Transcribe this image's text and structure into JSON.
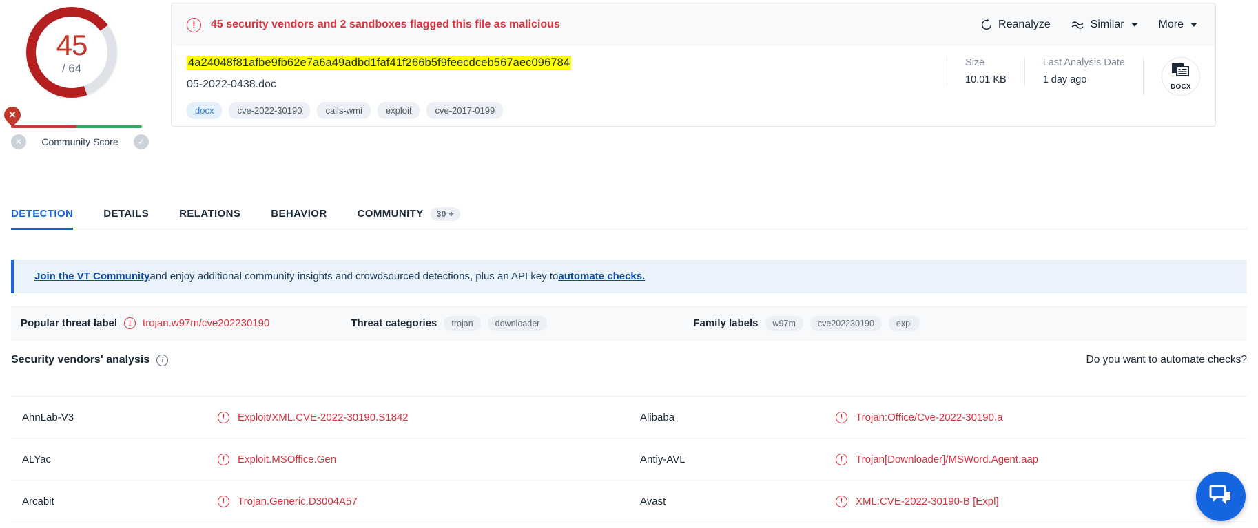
{
  "score": {
    "detections": "45",
    "total": "/ 64",
    "community_score_label": "Community Score",
    "negative_icon": "✕",
    "positive_icon": "✓",
    "pin_icon": "✕",
    "ring_color": "#b51f1f",
    "ring_track_color": "#dfe3e8"
  },
  "alert": {
    "message": "45 security vendors and 2 sandboxes flagged this file as malicious",
    "color": "#d9333f",
    "icon": "!"
  },
  "actions": {
    "reanalyze": "Reanalyze",
    "similar": "Similar",
    "more": "More"
  },
  "file": {
    "hash": "4a24048f81afbe9fb62e7a6a49adbd1faf41f266b5f9feecdceb567aec096784",
    "name": "05-2022-0438.doc",
    "tags": [
      {
        "label": "docx",
        "style": "blue"
      },
      {
        "label": "cve-2022-30190",
        "style": "grey"
      },
      {
        "label": "calls-wmi",
        "style": "grey"
      },
      {
        "label": "exploit",
        "style": "grey"
      },
      {
        "label": "cve-2017-0199",
        "style": "grey"
      }
    ],
    "size_label": "Size",
    "size_value": "10.01 KB",
    "last_analysis_label": "Last Analysis Date",
    "last_analysis_value": "1 day ago",
    "type_icon_label": "DOCX"
  },
  "tabs": [
    {
      "label": "DETECTION",
      "active": true,
      "badge": ""
    },
    {
      "label": "DETAILS",
      "active": false,
      "badge": ""
    },
    {
      "label": "RELATIONS",
      "active": false,
      "badge": ""
    },
    {
      "label": "BEHAVIOR",
      "active": false,
      "badge": ""
    },
    {
      "label": "COMMUNITY",
      "active": false,
      "badge": "30 +"
    }
  ],
  "banner": {
    "link1": "Join the VT Community",
    "middle": " and enjoy additional community insights and crowdsourced detections, plus an API key to ",
    "link2": "automate checks."
  },
  "threat": {
    "popular_label": "Popular threat label",
    "popular_value": "trojan.w97m/cve202230190",
    "categories_label": "Threat categories",
    "categories": [
      "trojan",
      "downloader"
    ],
    "family_label": "Family labels",
    "families": [
      "w97m",
      "cve202230190",
      "expl"
    ]
  },
  "vendors_section": {
    "title": "Security vendors' analysis",
    "automate_text": "Do you want to automate checks?"
  },
  "vendors": [
    {
      "left_name": "AhnLab-V3",
      "left_result": "Exploit/XML.CVE-2022-30190.S1842",
      "right_name": "Alibaba",
      "right_result": "Trojan:Office/Cve-2022-30190.a"
    },
    {
      "left_name": "ALYac",
      "left_result": "Exploit.MSOffice.Gen",
      "right_name": "Antiy-AVL",
      "right_result": "Trojan[Downloader]/MSWord.Agent.aap"
    },
    {
      "left_name": "Arcabit",
      "left_result": "Trojan.Generic.D3004A57",
      "right_name": "Avast",
      "right_result": "XML:CVE-2022-30190-B [Expl]"
    }
  ]
}
